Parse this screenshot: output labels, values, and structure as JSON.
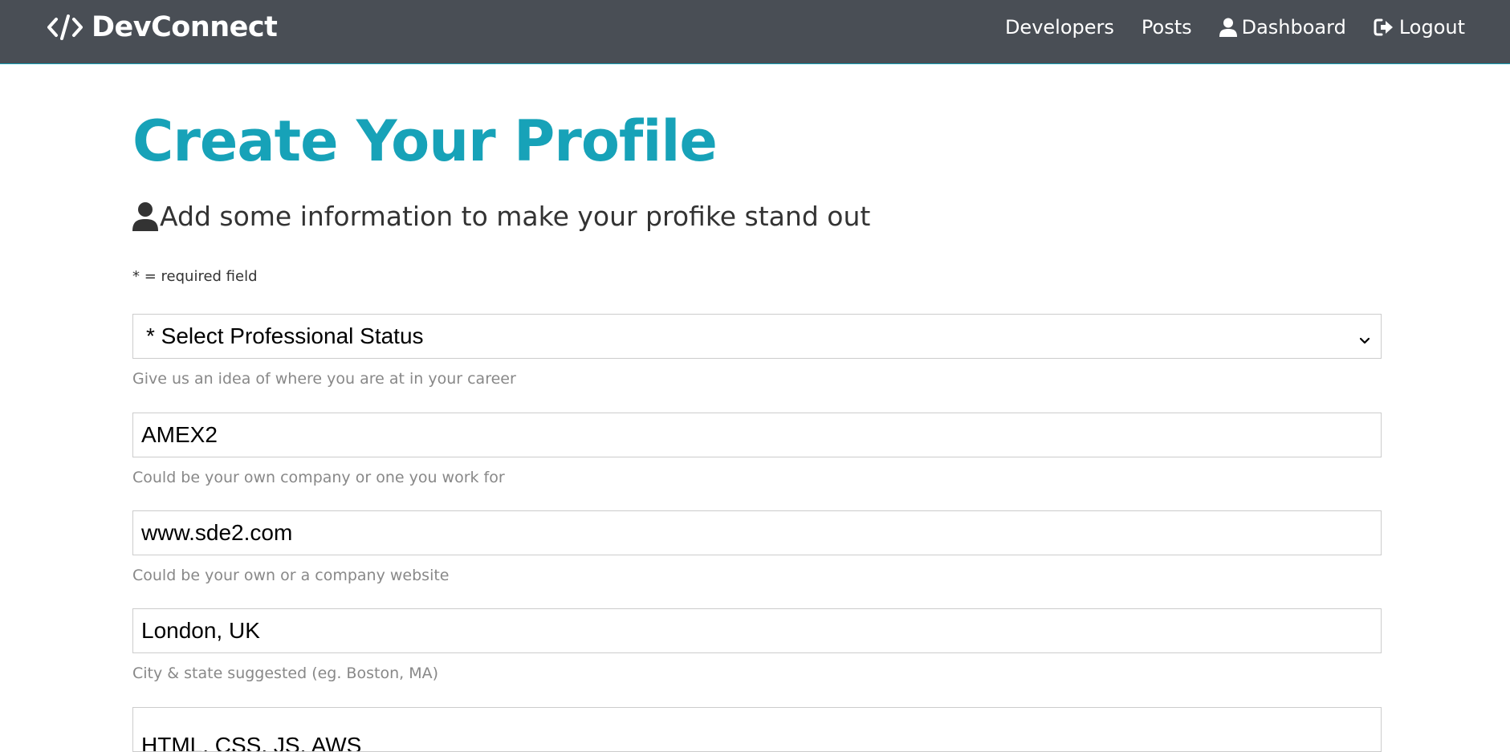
{
  "navbar": {
    "brand": "DevConnect",
    "links": [
      {
        "label": "Developers",
        "icon": ""
      },
      {
        "label": "Posts",
        "icon": ""
      },
      {
        "label": "Dashboard",
        "icon": "user-icon"
      },
      {
        "label": "Logout",
        "icon": "sign-out-icon"
      }
    ]
  },
  "colors": {
    "primary": "#17a2b8",
    "navbar_bg": "#494e55",
    "text_dark": "#333333",
    "hint_text": "#888888",
    "input_border": "#cccccc"
  },
  "page": {
    "title": "Create Your Profile",
    "lead": "Add some information to make your profike stand out",
    "lead_icon": "user-icon",
    "required_note": "* = required field"
  },
  "form": {
    "status": {
      "selected": "* Select Professional Status",
      "hint": "Give us an idea of where you are at in your career"
    },
    "company": {
      "value": "AMEX2",
      "hint": "Could be your own company or one you work for"
    },
    "website": {
      "value": "www.sde2.com",
      "hint": "Could be your own or a company website"
    },
    "location": {
      "value": "London, UK",
      "hint": "City & state suggested (eg. Boston, MA)"
    },
    "skills": {
      "value": "HTML, CSS, JS, AWS"
    }
  }
}
